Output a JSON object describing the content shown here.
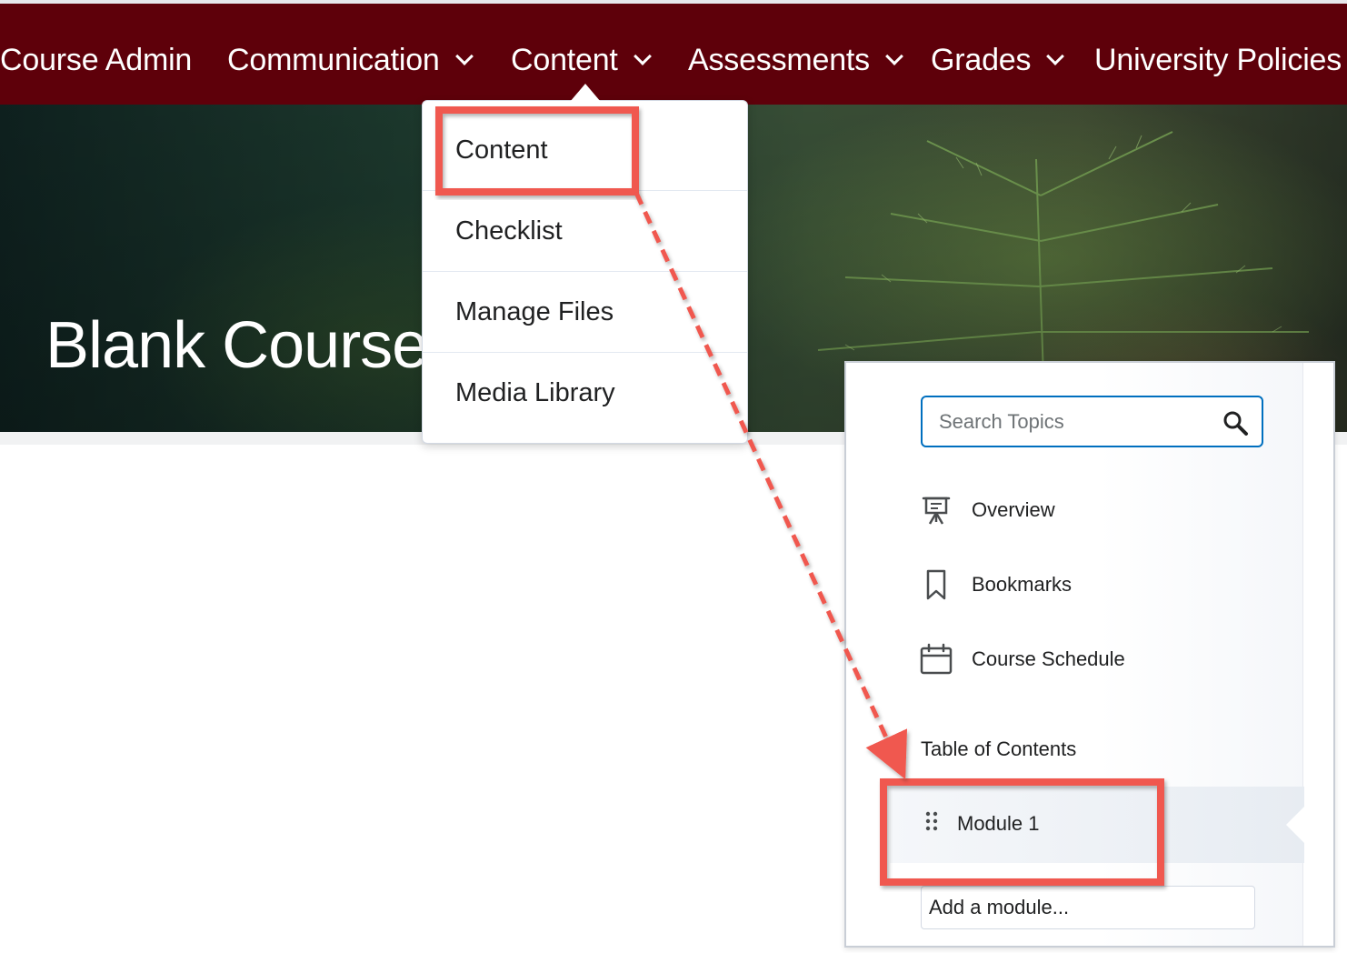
{
  "navbar": {
    "items": [
      {
        "label": "Course Admin",
        "has_dropdown": false
      },
      {
        "label": "Communication",
        "has_dropdown": true
      },
      {
        "label": "Content",
        "has_dropdown": true,
        "expanded": true
      },
      {
        "label": "Assessments",
        "has_dropdown": true
      },
      {
        "label": "Grades",
        "has_dropdown": true
      },
      {
        "label": "University Policies",
        "has_dropdown": false
      }
    ]
  },
  "hero": {
    "title": "Blank Course"
  },
  "content_menu": {
    "items": [
      {
        "label": "Content",
        "highlighted": true
      },
      {
        "label": "Checklist"
      },
      {
        "label": "Manage Files"
      },
      {
        "label": "Media Library"
      }
    ]
  },
  "content_panel": {
    "search": {
      "placeholder": "Search Topics",
      "value": ""
    },
    "links": [
      {
        "label": "Overview",
        "icon": "presentation-icon"
      },
      {
        "label": "Bookmarks",
        "icon": "bookmark-icon"
      },
      {
        "label": "Course Schedule",
        "icon": "calendar-icon"
      }
    ],
    "toc_heading": "Table of Contents",
    "modules": [
      {
        "label": "Module 1",
        "selected": true,
        "highlighted": true
      }
    ],
    "add_module_placeholder": "Add a module..."
  },
  "colors": {
    "navbar_bg": "#5e000a",
    "annotation": "#f0584f",
    "focus_blue": "#006fbf"
  }
}
